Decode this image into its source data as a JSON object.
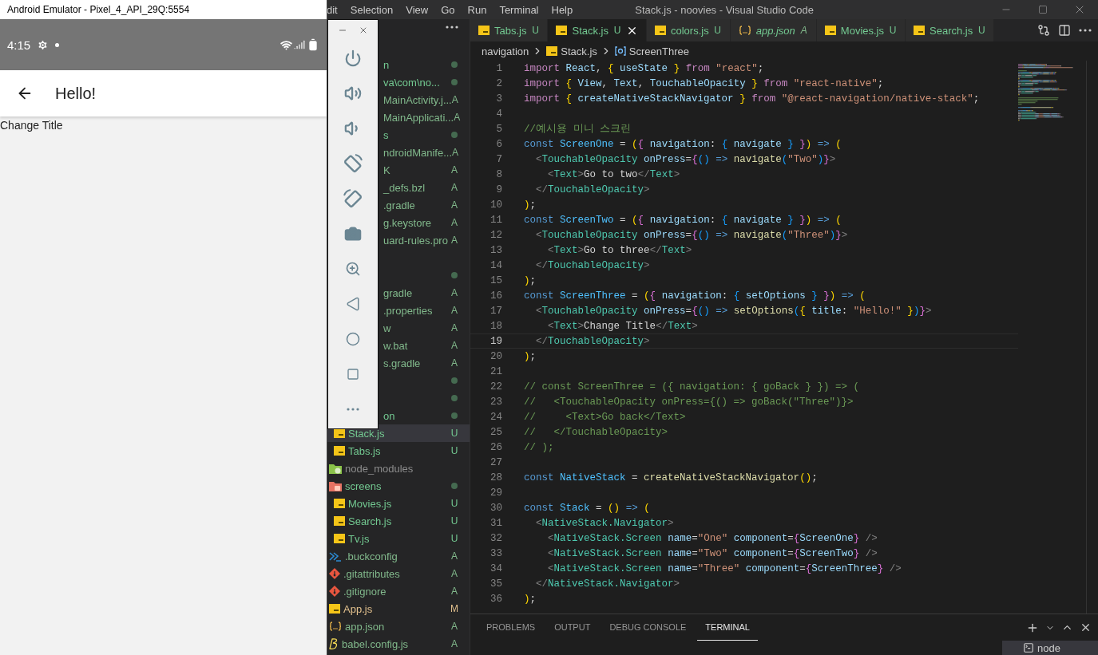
{
  "emulator": {
    "title": "Android Emulator - Pixel_4_API_29Q:5554",
    "status_bar": {
      "time": "4:15"
    },
    "app_bar": {
      "title": "Hello!"
    },
    "content": {
      "text": "Change Title"
    }
  },
  "emulator_toolbar": {
    "buttons": [
      {
        "kind": "power"
      },
      {
        "kind": "volume-up"
      },
      {
        "kind": "volume-down"
      },
      {
        "kind": "rotate-left"
      },
      {
        "kind": "rotate-right"
      },
      {
        "kind": "camera"
      },
      {
        "kind": "zoom"
      },
      {
        "kind": "back"
      },
      {
        "kind": "home"
      },
      {
        "kind": "overview"
      },
      {
        "kind": "more"
      }
    ]
  },
  "vscode": {
    "menu": [
      "dit",
      "Selection",
      "View",
      "Go",
      "Run",
      "Terminal",
      "Help"
    ],
    "title": "Stack.js - noovies - Visual Studio Code",
    "explorer": {
      "items": [
        {
          "kind": "clipped",
          "name": "n",
          "dot": true,
          "selected": false
        },
        {
          "kind": "clipped",
          "name": "va\\com\\no...",
          "dot": true,
          "selected": false
        },
        {
          "kind": "clipped",
          "name": "MainActivity.j...",
          "status": "A",
          "selected": false
        },
        {
          "kind": "clipped",
          "name": "MainApplicati...",
          "status": "A",
          "selected": false
        },
        {
          "kind": "clipped",
          "name": "s",
          "dot": true,
          "selected": false
        },
        {
          "kind": "clipped",
          "name": "ndroidManife...",
          "status": "A",
          "selected": false
        },
        {
          "kind": "clipped",
          "name": "K",
          "status": "A",
          "selected": false
        },
        {
          "kind": "clipped",
          "name": "_defs.bzl",
          "status": "A",
          "selected": false
        },
        {
          "kind": "clipped",
          "name": ".gradle",
          "status": "A",
          "selected": false
        },
        {
          "kind": "clipped",
          "name": "g.keystore",
          "status": "A",
          "selected": false
        },
        {
          "kind": "clipped",
          "name": "uard-rules.pro",
          "status": "A",
          "selected": false
        },
        {
          "kind": "clipped",
          "selected": false
        },
        {
          "kind": "clipped",
          "dot": true,
          "selected": false
        },
        {
          "kind": "clipped",
          "name": "gradle",
          "status": "A",
          "selected": false
        },
        {
          "kind": "clipped",
          "name": ".properties",
          "status": "A",
          "selected": false
        },
        {
          "kind": "clipped",
          "name": "w",
          "status": "A",
          "selected": false
        },
        {
          "kind": "clipped",
          "name": "w.bat",
          "status": "A",
          "selected": false
        },
        {
          "kind": "clipped",
          "name": "s.gradle",
          "status": "A",
          "selected": false
        },
        {
          "kind": "clipped",
          "dot": true,
          "selected": false
        },
        {
          "kind": "clipped",
          "dot": true,
          "selected": false
        },
        {
          "kind": "clipped",
          "name": "on",
          "dot": true,
          "selected": false,
          "children": [
            {
              "kind": "js",
              "name": "Stack.js",
              "status": "U",
              "selected": true
            },
            {
              "kind": "js",
              "name": "Tabs.js",
              "status": "U",
              "selected": false
            }
          ]
        },
        {
          "kind": "node-folder",
          "name": "node_modules",
          "ignored": true,
          "selected": false
        },
        {
          "kind": "screens-folder",
          "name": "screens",
          "dot": true,
          "selected": false,
          "children": [
            {
              "kind": "js",
              "name": "Movies.js",
              "status": "U",
              "selected": false
            },
            {
              "kind": "js",
              "name": "Search.js",
              "status": "U",
              "selected": false
            },
            {
              "kind": "js",
              "name": "Tv.js",
              "status": "U",
              "selected": false
            }
          ]
        },
        {
          "kind": "buck",
          "name": ".buckconfig",
          "status": "A",
          "selected": false
        },
        {
          "kind": "git",
          "name": ".gitattributes",
          "status": "A",
          "selected": false
        },
        {
          "kind": "git",
          "name": ".gitignore",
          "status": "A",
          "selected": false
        },
        {
          "kind": "js",
          "name": "App.js",
          "status": "M",
          "selected": false
        },
        {
          "kind": "json",
          "name": "app.json",
          "status": "A",
          "selected": false
        },
        {
          "kind": "babel",
          "name": "babel.config.js",
          "status": "A",
          "selected": false
        }
      ]
    },
    "tabs": [
      {
        "kind": "js",
        "label": "Tabs.js",
        "status": "U",
        "preview": false,
        "selected": false
      },
      {
        "kind": "js",
        "label": "Stack.js",
        "status": "U",
        "preview": false,
        "selected": true
      },
      {
        "kind": "js",
        "label": "colors.js",
        "status": "U",
        "preview": false,
        "selected": false
      },
      {
        "kind": "json",
        "label": "app.json",
        "status": "A",
        "preview": true,
        "selected": false
      },
      {
        "kind": "js",
        "label": "Movies.js",
        "status": "U",
        "preview": false,
        "selected": false
      },
      {
        "kind": "js",
        "label": "Search.js",
        "status": "U",
        "preview": false,
        "selected": false
      }
    ],
    "breadcrumb": [
      {
        "kind": "folder",
        "label": "navigation"
      },
      {
        "kind": "js",
        "label": "Stack.js"
      },
      {
        "kind": "symbol",
        "label": "ScreenThree"
      }
    ],
    "code": [
      {
        "number": "1",
        "current": false,
        "text": "import React, { useState } from \"react\";"
      },
      {
        "number": "2",
        "current": false,
        "text": "import { View, Text, TouchableOpacity } from \"react-native\";"
      },
      {
        "number": "3",
        "current": false,
        "text": "import { createNativeStackNavigator } from \"@react-navigation/native-stack\";"
      },
      {
        "number": "4",
        "current": false
      },
      {
        "number": "5",
        "current": false,
        "text": "//예시용 미니 스크린"
      },
      {
        "number": "6",
        "current": false,
        "text": "const ScreenOne = ({ navigation: { navigate } }) => ("
      },
      {
        "number": "7",
        "current": false,
        "text": "  <TouchableOpacity onPress={() => navigate(\"Two\")}>"
      },
      {
        "number": "8",
        "current": false,
        "text": "    <Text>Go to two</Text>"
      },
      {
        "number": "9",
        "current": false,
        "text": "  </TouchableOpacity>"
      },
      {
        "number": "10",
        "current": false,
        "text": ");"
      },
      {
        "number": "11",
        "current": false,
        "text": "const ScreenTwo = ({ navigation: { navigate } }) => ("
      },
      {
        "number": "12",
        "current": false,
        "text": "  <TouchableOpacity onPress={() => navigate(\"Three\")}>"
      },
      {
        "number": "13",
        "current": false,
        "text": "    <Text>Go to three</Text>"
      },
      {
        "number": "14",
        "current": false,
        "text": "  </TouchableOpacity>"
      },
      {
        "number": "15",
        "current": false,
        "text": ");"
      },
      {
        "number": "16",
        "current": false,
        "text": "const ScreenThree = ({ navigation: { setOptions } }) => ("
      },
      {
        "number": "17",
        "current": false,
        "text": "  <TouchableOpacity onPress={() => setOptions({ title: \"Hello!\" })}>"
      },
      {
        "number": "18",
        "current": false,
        "text": "    <Text>Change Title</Text>"
      },
      {
        "number": "19",
        "current": true,
        "text": "  </TouchableOpacity>"
      },
      {
        "number": "20",
        "current": false,
        "text": ");"
      },
      {
        "number": "21",
        "current": false
      },
      {
        "number": "22",
        "current": false,
        "text": "// const ScreenThree = ({ navigation: { goBack } }) => ("
      },
      {
        "number": "23",
        "current": false,
        "text": "//   <TouchableOpacity onPress={() => goBack(\"Three\")}>"
      },
      {
        "number": "24",
        "current": false,
        "text": "//     <Text>Go back</Text>"
      },
      {
        "number": "25",
        "current": false,
        "text": "//   </TouchableOpacity>"
      },
      {
        "number": "26",
        "current": false,
        "text": "// );"
      },
      {
        "number": "27",
        "current": false
      },
      {
        "number": "28",
        "current": false,
        "text": "const NativeStack = createNativeStackNavigator();"
      },
      {
        "number": "29",
        "current": false
      },
      {
        "number": "30",
        "current": false,
        "text": "const Stack = () => ("
      },
      {
        "number": "31",
        "current": false,
        "text": "  <NativeStack.Navigator>"
      },
      {
        "number": "32",
        "current": false,
        "text": "    <NativeStack.Screen name=\"One\" component={ScreenOne} />"
      },
      {
        "number": "33",
        "current": false,
        "text": "    <NativeStack.Screen name=\"Two\" component={ScreenTwo} />"
      },
      {
        "number": "34",
        "current": false,
        "text": "    <NativeStack.Screen name=\"Three\" component={ScreenThree} />"
      },
      {
        "number": "35",
        "current": false,
        "text": "  </NativeStack.Navigator>"
      },
      {
        "number": "36",
        "current": false,
        "text": ");"
      }
    ],
    "panel": {
      "tabs": [
        {
          "label": "PROBLEMS",
          "selected": false
        },
        {
          "label": "OUTPUT",
          "selected": false
        },
        {
          "label": "DEBUG CONSOLE",
          "selected": false
        },
        {
          "label": "TERMINAL",
          "selected": true
        }
      ],
      "terminal": {
        "label": "node"
      }
    }
  }
}
